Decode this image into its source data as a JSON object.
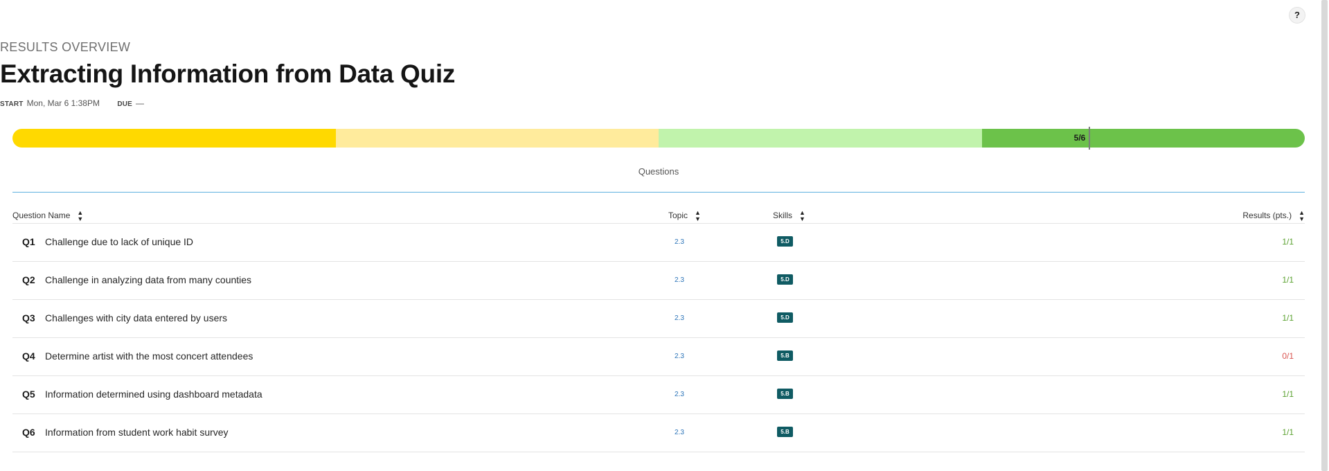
{
  "header": {
    "eyebrow": "RESULTS OVERVIEW",
    "title": "Extracting Information from Data Quiz",
    "start_label": "START",
    "start_value": "Mon, Mar 6 1:38PM",
    "due_label": "DUE",
    "due_value": "—"
  },
  "help": {
    "label": "?"
  },
  "progress": {
    "label": "5/6",
    "score": 5,
    "total": 6,
    "colors": [
      "#ffd900",
      "#ffeb9c",
      "#c1f3ac",
      "#6cc24a"
    ]
  },
  "section": {
    "tab_label": "Questions"
  },
  "table": {
    "columns": {
      "name": "Question Name",
      "topic": "Topic",
      "skills": "Skills",
      "results": "Results (pts.)"
    },
    "rows": [
      {
        "num": "Q1",
        "name": "Challenge due to lack of unique ID",
        "topic": "2.3",
        "skill": "5.D",
        "result": "1/1",
        "result_color": "#5aa12f"
      },
      {
        "num": "Q2",
        "name": "Challenge in analyzing data from many counties",
        "topic": "2.3",
        "skill": "5.D",
        "result": "1/1",
        "result_color": "#5aa12f"
      },
      {
        "num": "Q3",
        "name": "Challenges with city data entered by users",
        "topic": "2.3",
        "skill": "5.D",
        "result": "1/1",
        "result_color": "#5aa12f"
      },
      {
        "num": "Q4",
        "name": "Determine artist with the most concert attendees",
        "topic": "2.3",
        "skill": "5.B",
        "result": "0/1",
        "result_color": "#d9534f"
      },
      {
        "num": "Q5",
        "name": "Information determined using dashboard metadata",
        "topic": "2.3",
        "skill": "5.B",
        "result": "1/1",
        "result_color": "#5aa12f"
      },
      {
        "num": "Q6",
        "name": "Information from student work habit survey",
        "topic": "2.3",
        "skill": "5.B",
        "result": "1/1",
        "result_color": "#5aa12f"
      }
    ]
  }
}
